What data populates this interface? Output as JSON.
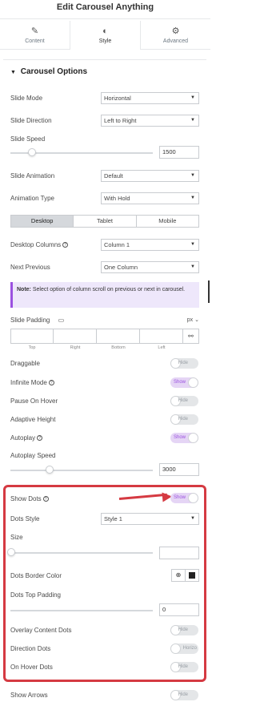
{
  "header": {
    "title": "Edit Carousel Anything"
  },
  "tabs": [
    {
      "label": "Content",
      "icon": "pencil-icon"
    },
    {
      "label": "Style",
      "icon": "contrast-icon"
    },
    {
      "label": "Advanced",
      "icon": "gear-icon"
    }
  ],
  "section": {
    "title": "Carousel Options"
  },
  "fields": {
    "slide_mode": {
      "label": "Slide Mode",
      "value": "Horizontal"
    },
    "slide_direction": {
      "label": "Slide Direction",
      "value": "Left to Right"
    },
    "slide_speed": {
      "label": "Slide Speed",
      "value": "1500"
    },
    "slide_animation": {
      "label": "Slide Animation",
      "value": "Default"
    },
    "animation_type": {
      "label": "Animation Type",
      "value": "With Hold"
    },
    "devices": [
      "Desktop",
      "Tablet",
      "Mobile"
    ],
    "desktop_columns": {
      "label": "Desktop Columns",
      "value": "Column 1"
    },
    "next_previous": {
      "label": "Next Previous",
      "value": "One Column"
    },
    "note": {
      "bold": "Note:",
      "text": "Select option of column scroll on previous or next in carousel."
    },
    "slide_padding": {
      "label": "Slide Padding",
      "unit": "px",
      "sides": [
        "Top",
        "Right",
        "Bottom",
        "Left"
      ]
    },
    "draggable": {
      "label": "Draggable",
      "state": "Hide"
    },
    "infinite_mode": {
      "label": "Infinite Mode",
      "state": "Show"
    },
    "pause_on_hover": {
      "label": "Pause On Hover",
      "state": "Hide"
    },
    "adaptive_height": {
      "label": "Adaptive Height",
      "state": "Hide"
    },
    "autoplay": {
      "label": "Autoplay",
      "state": "Show"
    },
    "autoplay_speed": {
      "label": "Autoplay Speed",
      "value": "3000"
    },
    "show_dots": {
      "label": "Show Dots",
      "state": "Show"
    },
    "dots_style": {
      "label": "Dots Style",
      "value": "Style 1"
    },
    "size": {
      "label": "Size",
      "value": ""
    },
    "dots_border_color": {
      "label": "Dots Border Color",
      "color": "#222222"
    },
    "dots_top_padding": {
      "label": "Dots Top Padding",
      "value": "0"
    },
    "overlay_content_dots": {
      "label": "Overlay Content Dots",
      "state": "Hide"
    },
    "direction_dots": {
      "label": "Direction Dots",
      "state": "Horizo"
    },
    "on_hover_dots": {
      "label": "On Hover Dots",
      "state": "Hide"
    },
    "show_arrows": {
      "label": "Show Arrows",
      "state": "Hide"
    }
  },
  "colors": {
    "accent": "#9b51e0",
    "highlight": "#d53a42",
    "toggle_on": "#e5d5f5"
  }
}
